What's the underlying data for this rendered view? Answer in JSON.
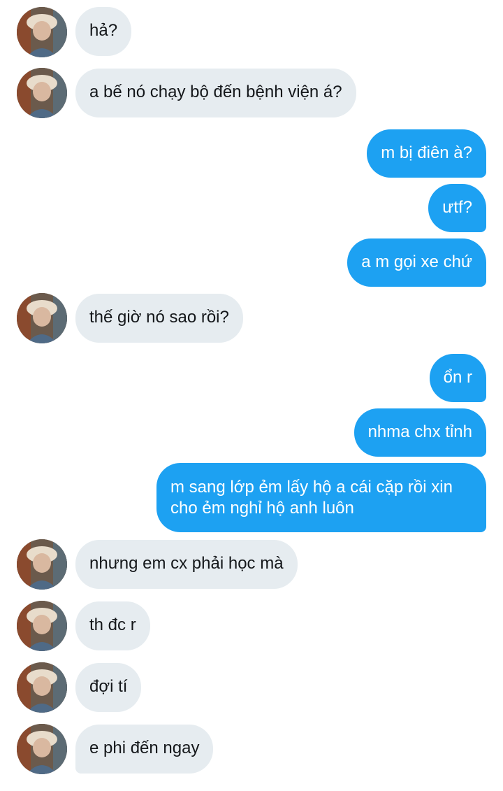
{
  "thread": {
    "messages": [
      {
        "side": "in",
        "text": "hả?"
      },
      {
        "side": "in",
        "text": "a bế nó chạy bộ đến bệnh viện á?"
      },
      {
        "side": "out",
        "text": "m bị điên à?"
      },
      {
        "side": "out",
        "text": "ưtf?"
      },
      {
        "side": "out",
        "text": "a m gọi xe chứ"
      },
      {
        "side": "in",
        "text": "thế giờ nó sao rồi?"
      },
      {
        "side": "out",
        "text": "ổn r"
      },
      {
        "side": "out",
        "text": "nhma chx tỉnh"
      },
      {
        "side": "out",
        "text": "m sang lớp ẻm lấy hộ a cái cặp rồi xin cho ẻm nghỉ hộ anh luôn"
      },
      {
        "side": "in",
        "text": "nhưng em cx phải học mà"
      },
      {
        "side": "in",
        "text": "th đc r"
      },
      {
        "side": "in",
        "text": "đợi tí"
      },
      {
        "side": "in",
        "text": "e phi đến ngay"
      }
    ]
  },
  "colors": {
    "incoming_bubble": "#e6ecf0",
    "outgoing_bubble": "#1da1f2",
    "incoming_text": "#14171a",
    "outgoing_text": "#ffffff"
  },
  "icons": {
    "avatar": "user-avatar-photo"
  }
}
